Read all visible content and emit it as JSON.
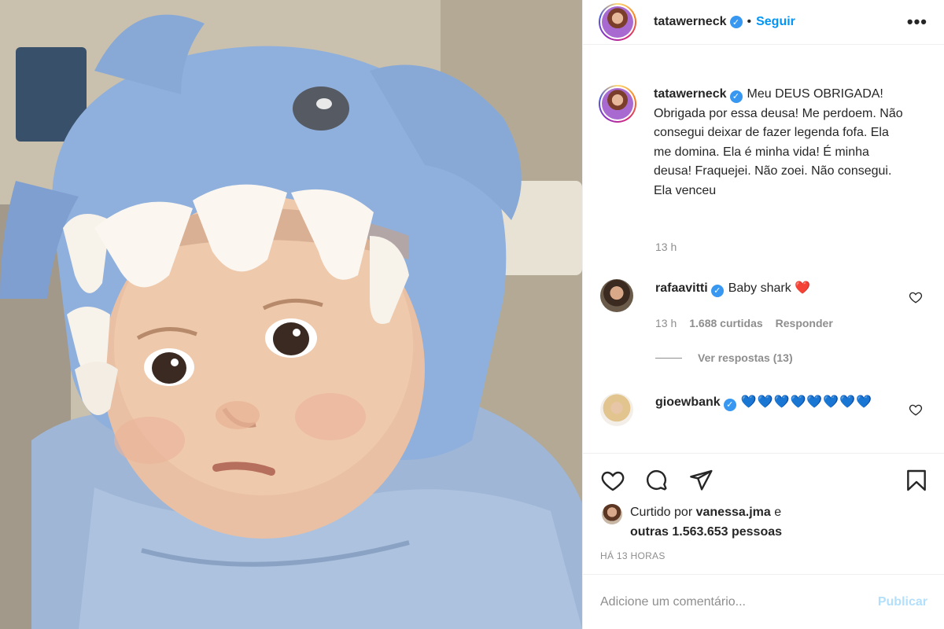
{
  "post": {
    "author": "tatawerneck",
    "follow_label": "Seguir",
    "separator": "•",
    "more_label": "•••"
  },
  "photo": {
    "alt": "Bebê com toalha de tubarão azul"
  },
  "caption": {
    "author": "tatawerneck",
    "text": "Meu DEUS OBRIGADA! Obrigada por essa deusa! Me perdoem. Não consegui deixar de fazer legenda fofa. Ela me domina. Ela é minha vida! É minha deusa! Fraquejei. Não zoei. Não consegui. Ela venceu",
    "time": "13 h"
  },
  "comments": [
    {
      "author": "rafaavitti",
      "text": "Baby shark ❤️",
      "time": "13 h",
      "likes": "1.688 curtidas",
      "reply_label": "Responder",
      "view_replies": "Ver respostas (13)"
    },
    {
      "author": "gioewbank",
      "text": "💙💙💙💙💙💙💙💙"
    }
  ],
  "likes": {
    "prefix": "Curtido por",
    "user": "vanessa.jma",
    "middle": "e",
    "others": "outras 1.563.653 pessoas"
  },
  "time_ago": "HÁ 13 HORAS",
  "add_comment": {
    "placeholder": "Adicione um comentário...",
    "publish_label": "Publicar"
  },
  "icons": {
    "like": "heart-icon",
    "comment": "comment-icon",
    "share": "share-icon",
    "save": "bookmark-icon",
    "comment_like": "heart-small-icon",
    "verified": "verified-badge-icon",
    "more": "more-options-icon"
  },
  "colors": {
    "accent": "#0095f6",
    "verified": "#3897f0",
    "muted": "#8e8e8e",
    "publish_disabled": "#b2dffc",
    "heart_red": "#ed1c24",
    "heart_blue": "#1877f2"
  }
}
